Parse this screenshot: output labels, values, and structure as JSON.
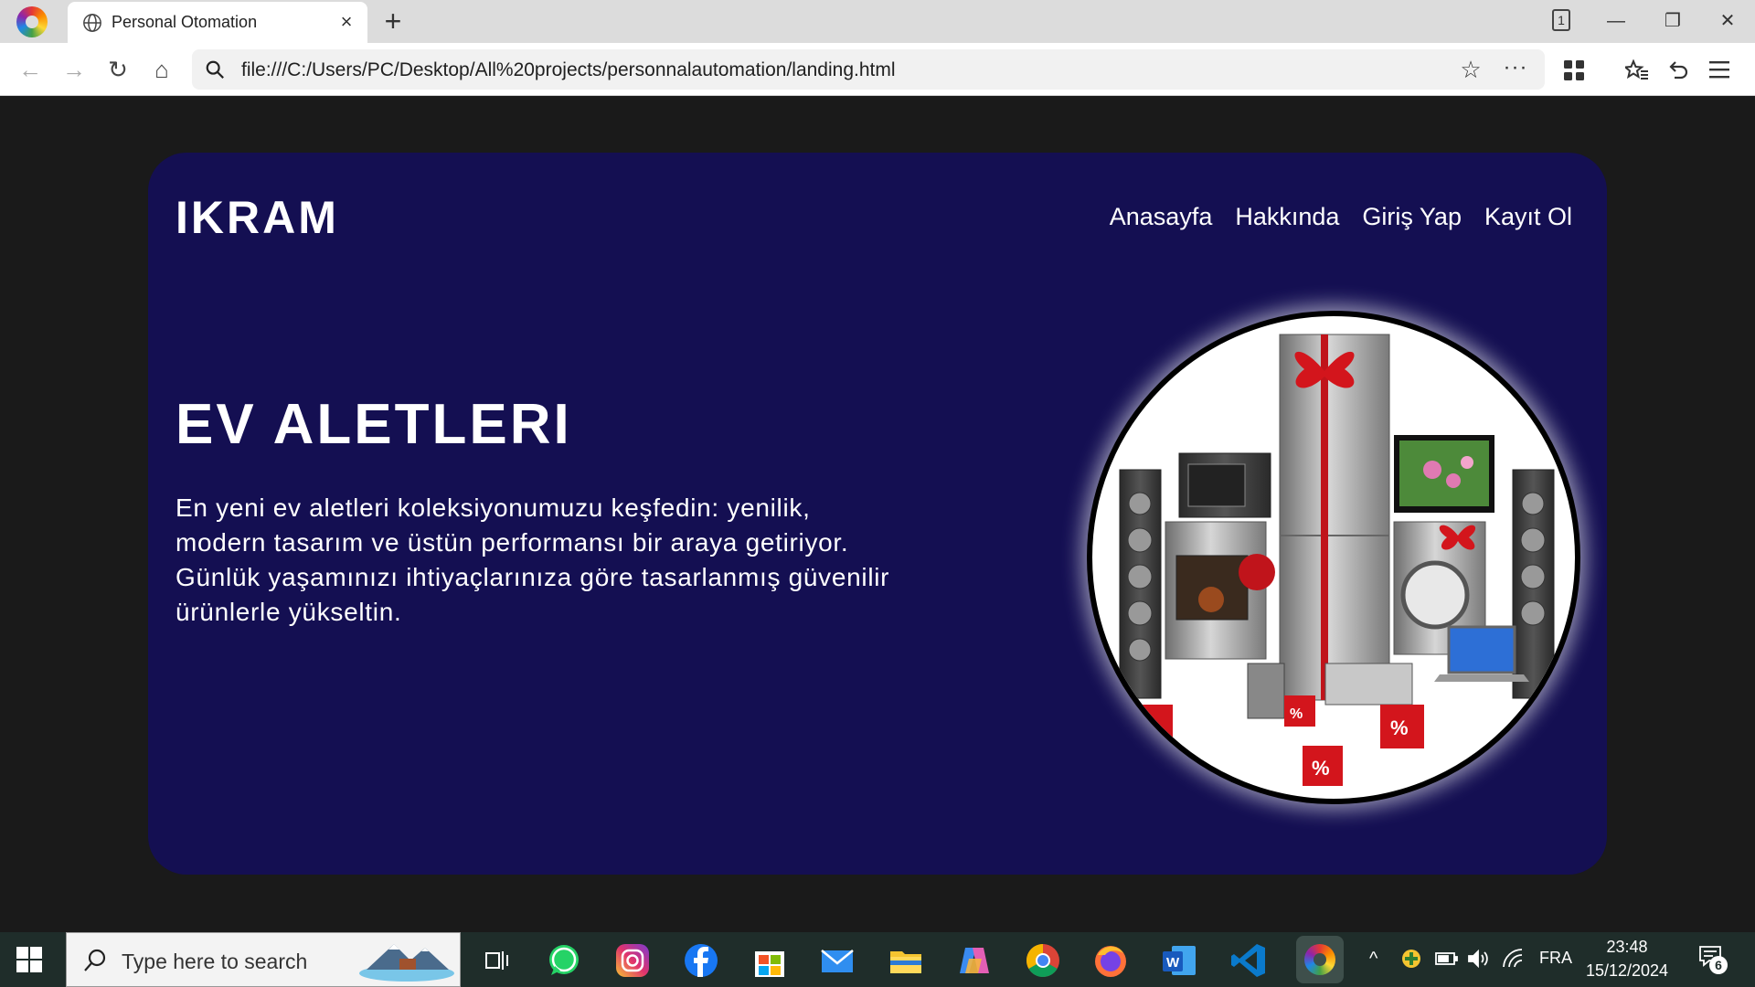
{
  "browser": {
    "tab_title": "Personal Otomation",
    "tab_close": "×",
    "new_tab": "+",
    "tab_count": "1",
    "address": "file:///C:/Users/PC/Desktop/All%20projects/personnalautomation/landing.html",
    "back": "←",
    "forward": "→",
    "reload": "↻",
    "home": "⌂",
    "star": "☆",
    "more": "···",
    "window_controls": {
      "minimize": "—",
      "restore": "❐",
      "close": "✕"
    }
  },
  "page": {
    "logo": "IKRAM",
    "nav": [
      "Anasayfa",
      "Hakkında",
      "Giriş Yap",
      "Kayıt Ol"
    ],
    "hero_title": "EV ALETLERI",
    "hero_text": "En yeni ev aletleri koleksiyonumuzu keşfedin: yenilik, modern tasarım ve üstün performansı bir araya getiriyor. Günlük yaşamınızı ihtiyaçlarınıza göre tasarlanmış güvenilir ürünlerle yükseltin.",
    "hero_image_icon": "home-appliances-image"
  },
  "taskbar": {
    "search_placeholder": "Type here to search",
    "apps": [
      "task-view",
      "whatsapp",
      "instagram",
      "facebook",
      "microsoft-store",
      "mail",
      "file-explorer",
      "copilot",
      "chrome",
      "firefox",
      "word",
      "vscode",
      "browser"
    ],
    "language": "FRA",
    "time": "23:48",
    "date": "15/12/2024",
    "notification_count": "6"
  },
  "colors": {
    "page_bg": "#1a1a1a",
    "card_bg": "#140f52",
    "text": "#ffffff",
    "taskbar_bg": "#1f2d2a"
  }
}
